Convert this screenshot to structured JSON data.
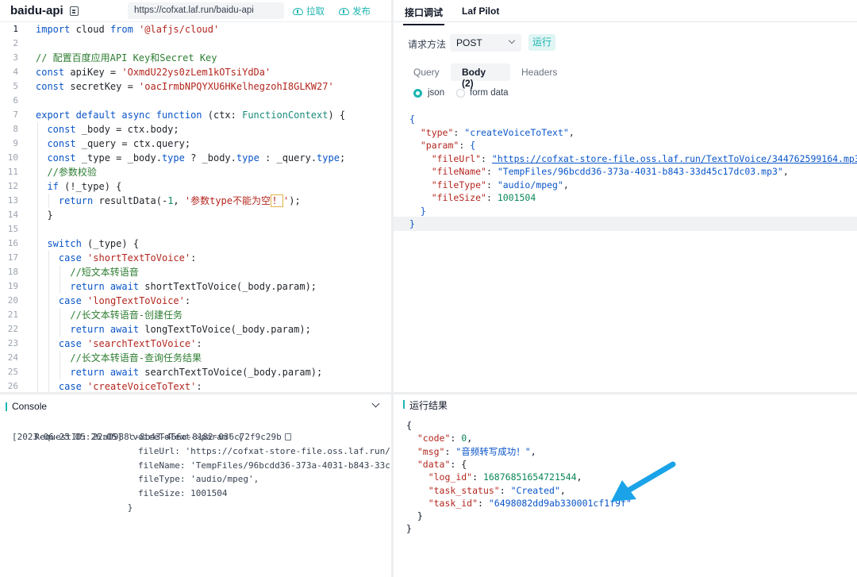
{
  "header": {
    "app_title": "baidu-api",
    "url": "https://cofxat.laf.run/baidu-api",
    "pull_label": "拉取",
    "publish_label": "发布"
  },
  "editor": {
    "lines": [
      {
        "n": "1",
        "html": "<span class=\"kw\">import</span> cloud <span class=\"kw\">from</span> <span class=\"str\">'@lafjs/cloud'</span>"
      },
      {
        "n": "2",
        "html": ""
      },
      {
        "n": "3",
        "html": "<span class=\"cmt\">// 配置百度应用API Key和Secret Key</span>"
      },
      {
        "n": "4",
        "html": "<span class=\"kw\">const</span> apiKey = <span class=\"str\">'OxmdU22ys0zLem1kOTsiYdDa'</span>"
      },
      {
        "n": "5",
        "html": "<span class=\"kw\">const</span> secretKey = <span class=\"str\">'oacIrmbNPQYXU6HKelhegzohI8GLKW27'</span>"
      },
      {
        "n": "6",
        "html": ""
      },
      {
        "n": "7",
        "html": "<span class=\"kw\">export default async function</span> (ctx: <span class=\"typ\">FunctionContext</span>) {"
      },
      {
        "n": "8",
        "html": "  <span class=\"kw\">const</span> _body = ctx.body;"
      },
      {
        "n": "9",
        "html": "  <span class=\"kw\">const</span> _query = ctx.query;"
      },
      {
        "n": "10",
        "html": "  <span class=\"kw\">const</span> _type = _body.<span class=\"prop\">type</span> ? _body.<span class=\"prop\">type</span> : _query.<span class=\"prop\">type</span>;"
      },
      {
        "n": "11",
        "html": "  <span class=\"cmt\">//参数校验</span>"
      },
      {
        "n": "12",
        "html": "  <span class=\"kw\">if</span> (!_type) {"
      },
      {
        "n": "13",
        "html": "    <span class=\"kw\">return</span> resultData(-<span class=\"num\">1</span>, <span class=\"str\">'参数type不能为空<span class=\"cursor-box\">！</span>'</span>);"
      },
      {
        "n": "14",
        "html": "  }"
      },
      {
        "n": "15",
        "html": ""
      },
      {
        "n": "16",
        "html": "  <span class=\"kw\">switch</span> (_type) {"
      },
      {
        "n": "17",
        "html": "    <span class=\"kw\">case</span> <span class=\"str\">'shortTextToVoice'</span>:"
      },
      {
        "n": "18",
        "html": "      <span class=\"cmt\">//短文本转语音</span>"
      },
      {
        "n": "19",
        "html": "      <span class=\"kw\">return await</span> shortTextToVoice(_body.param);"
      },
      {
        "n": "20",
        "html": "    <span class=\"kw\">case</span> <span class=\"str\">'longTextToVoice'</span>:"
      },
      {
        "n": "21",
        "html": "      <span class=\"cmt\">//长文本转语音-创建任务</span>"
      },
      {
        "n": "22",
        "html": "      <span class=\"kw\">return await</span> longTextToVoice(_body.param);"
      },
      {
        "n": "23",
        "html": "    <span class=\"kw\">case</span> <span class=\"str\">'searchTextToVoice'</span>:"
      },
      {
        "n": "24",
        "html": "      <span class=\"cmt\">//长文本转语音-查询任务结果</span>"
      },
      {
        "n": "25",
        "html": "      <span class=\"kw\">return await</span> searchTextToVoice(_body.param);"
      },
      {
        "n": "26",
        "html": "    <span class=\"kw\">case</span> <span class=\"str\">'createVoiceToText'</span>:"
      }
    ]
  },
  "request": {
    "tab_api": "接口调试",
    "tab_pilot": "Laf Pilot",
    "method_label": "请求方法",
    "method_value": "POST",
    "run_label": "运行",
    "subtab_query": "Query",
    "subtab_body": "Body (2)",
    "subtab_headers": "Headers",
    "radio_json": "json",
    "radio_form": "form data",
    "body_lines": [
      {
        "i": 0,
        "html": "<span class=\"jbr\">{</span>"
      },
      {
        "i": 1,
        "html": "  <span class=\"jkey\">\"type\"</span>: <span class=\"jstr\">\"createVoiceToText\"</span>,"
      },
      {
        "i": 1,
        "html": "  <span class=\"jkey\">\"param\"</span>: <span class=\"jbr\">{</span>"
      },
      {
        "i": 2,
        "html": "    <span class=\"jkey\">\"fileUrl\"</span>: <span class=\"jlink\">\"https://cofxat-store-file.oss.laf.run/TextToVoice/344762599164.mp3\"</span>,"
      },
      {
        "i": 2,
        "html": "    <span class=\"jkey\">\"fileName\"</span>: <span class=\"jstr\">\"TempFiles/96bcdd36-373a-4031-b843-33d45c17dc03.mp3\"</span>,"
      },
      {
        "i": 2,
        "html": "    <span class=\"jkey\">\"fileType\"</span>: <span class=\"jstr\">\"audio/mpeg\"</span>,"
      },
      {
        "i": 2,
        "html": "    <span class=\"jkey\">\"fileSize\"</span>: <span class=\"jnum\">1001504</span>"
      },
      {
        "i": 1,
        "html": "  <span class=\"jbr\">}</span>"
      },
      {
        "i": 0,
        "html": "<span class=\"jbr\">}</span>"
      }
    ]
  },
  "console": {
    "title": "Console",
    "request_id": "RequestID: 22a0988c-8b43-466a-8182-036c72f9c29b",
    "lines": [
      "[2023-06-25 05:26:05] 'voiceToText->param' {",
      "                        fileUrl: 'https://cofxat-store-file.oss.laf.run/",
      "                        fileName: 'TempFiles/96bcdd36-373a-4031-b843-33c",
      "                        fileType: 'audio/mpeg',",
      "                        fileSize: 1001504",
      "                      }"
    ]
  },
  "result": {
    "title": "运行结果",
    "lines": [
      "<span>{</span>",
      "  <span class=\"jkey\">\"code\"</span>: <span class=\"jnum\">0</span>,",
      "  <span class=\"jkey\">\"msg\"</span>: <span class=\"jstr\">\"音频转写成功！\"</span>,",
      "  <span class=\"jkey\">\"data\"</span>: {",
      "    <span class=\"jkey\">\"log_id\"</span>: <span class=\"jnum\">16876851654721544</span>,",
      "    <span class=\"jkey\">\"task_status\"</span>: <span class=\"jstr\">\"Created\"</span>,",
      "    <span class=\"jkey\">\"task_id\"</span>: <span class=\"jstr\">\"6498082dd9ab330001cf1f9f\"</span>",
      "  }",
      "}"
    ]
  },
  "colors": {
    "accent": "#1cb5b0",
    "arrow": "#1aa3e8"
  }
}
